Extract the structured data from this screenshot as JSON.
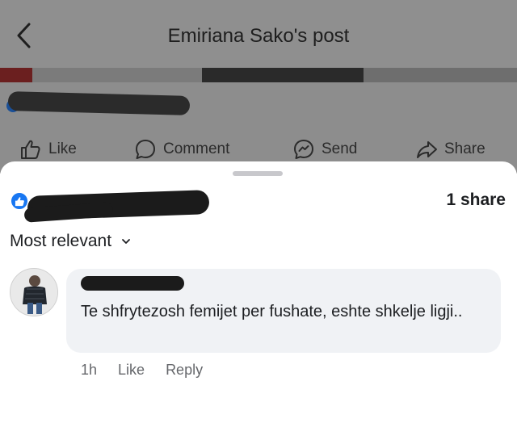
{
  "header": {
    "title": "Emiriana Sako's post"
  },
  "actions": {
    "like": "Like",
    "comment": "Comment",
    "send": "Send",
    "share": "Share"
  },
  "reactions": {
    "share_count": "1 share"
  },
  "sort": {
    "label": "Most relevant"
  },
  "comment": {
    "text": "Te shfrytezosh femijet per fushate, eshte shkelje ligji..",
    "time": "1h",
    "like_label": "Like",
    "reply_label": "Reply"
  },
  "colors": {
    "facebook_blue": "#1877f2",
    "bubble_bg": "#f0f2f5",
    "meta_gray": "#65676b"
  }
}
